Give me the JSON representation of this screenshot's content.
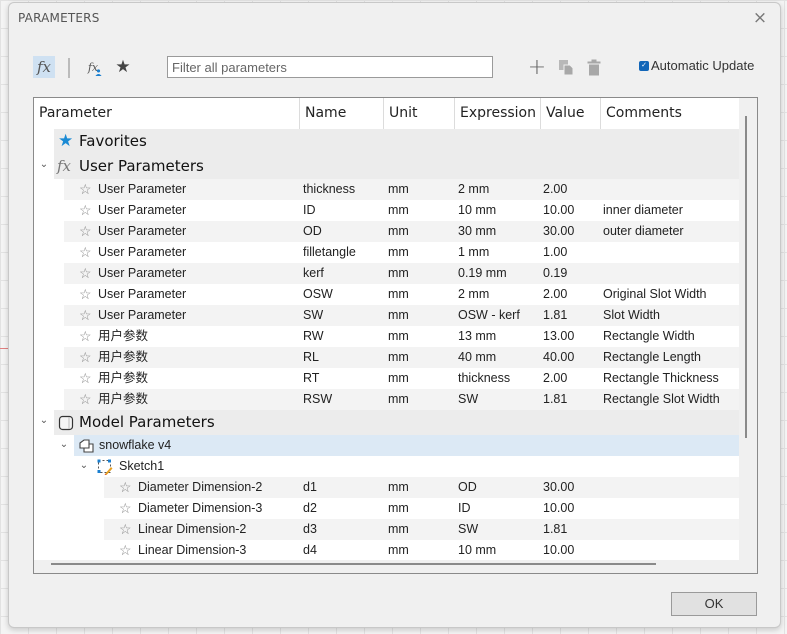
{
  "window": {
    "title": "PARAMETERS",
    "close_icon": "×"
  },
  "toolbar": {
    "all_params_icon": "fx",
    "user_params_icon": "fx",
    "favorites_icon": "★",
    "filter_placeholder": "Filter all parameters",
    "filter_value": "",
    "add_icon": "+",
    "auto_update_label": "Automatic Update",
    "auto_update_checked": true,
    "auto_update_check": "✓"
  },
  "columns": [
    "Parameter",
    "Name",
    "Unit",
    "Expression",
    "Value",
    "Comments"
  ],
  "groups": {
    "favorites": {
      "label": "Favorites",
      "icon": "★"
    },
    "user": {
      "label": "User Parameters",
      "icon": "fx",
      "chevron": "⌄"
    },
    "model": {
      "label": "Model Parameters",
      "chevron": "⌄"
    }
  },
  "user_params": [
    {
      "param": "User Parameter",
      "name": "thickness",
      "unit": "mm",
      "expression": "2 mm",
      "value": "2.00",
      "comment": ""
    },
    {
      "param": "User Parameter",
      "name": "ID",
      "unit": "mm",
      "expression": "10 mm",
      "value": "10.00",
      "comment": "inner diameter"
    },
    {
      "param": "User Parameter",
      "name": "OD",
      "unit": "mm",
      "expression": "30 mm",
      "value": "30.00",
      "comment": "outer diameter"
    },
    {
      "param": "User Parameter",
      "name": "filletangle",
      "unit": "mm",
      "expression": "1 mm",
      "value": "1.00",
      "comment": ""
    },
    {
      "param": "User Parameter",
      "name": "kerf",
      "unit": "mm",
      "expression": "0.19 mm",
      "value": "0.19",
      "comment": ""
    },
    {
      "param": "User Parameter",
      "name": "OSW",
      "unit": "mm",
      "expression": "2 mm",
      "value": "2.00",
      "comment": "Original Slot Width"
    },
    {
      "param": "User Parameter",
      "name": "SW",
      "unit": "mm",
      "expression": "OSW - kerf",
      "value": "1.81",
      "comment": "Slot Width"
    },
    {
      "param": "用户参数",
      "name": "RW",
      "unit": "mm",
      "expression": "13 mm",
      "value": "13.00",
      "comment": "Rectangle Width"
    },
    {
      "param": "用户参数",
      "name": "RL",
      "unit": "mm",
      "expression": "40 mm",
      "value": "40.00",
      "comment": "Rectangle Length"
    },
    {
      "param": "用户参数",
      "name": "RT",
      "unit": "mm",
      "expression": "thickness",
      "value": "2.00",
      "comment": "Rectangle Thickness"
    },
    {
      "param": "用户参数",
      "name": "RSW",
      "unit": "mm",
      "expression": "SW",
      "value": "1.81",
      "comment": "Rectangle Slot Width"
    }
  ],
  "model_tree": {
    "component": {
      "label": "snowflake v4",
      "chevron": "⌄"
    },
    "sketch": {
      "label": "Sketch1",
      "chevron": "⌄"
    },
    "params": [
      {
        "param": "Diameter Dimension-2",
        "name": "d1",
        "unit": "mm",
        "expression": "OD",
        "value": "30.00",
        "comment": ""
      },
      {
        "param": "Diameter Dimension-3",
        "name": "d2",
        "unit": "mm",
        "expression": "ID",
        "value": "10.00",
        "comment": ""
      },
      {
        "param": "Linear Dimension-2",
        "name": "d3",
        "unit": "mm",
        "expression": "SW",
        "value": "1.81",
        "comment": ""
      },
      {
        "param": "Linear Dimension-3",
        "name": "d4",
        "unit": "mm",
        "expression": "10 mm",
        "value": "10.00",
        "comment": ""
      }
    ]
  },
  "row_star_icon": "☆",
  "footer": {
    "ok_label": "OK"
  }
}
